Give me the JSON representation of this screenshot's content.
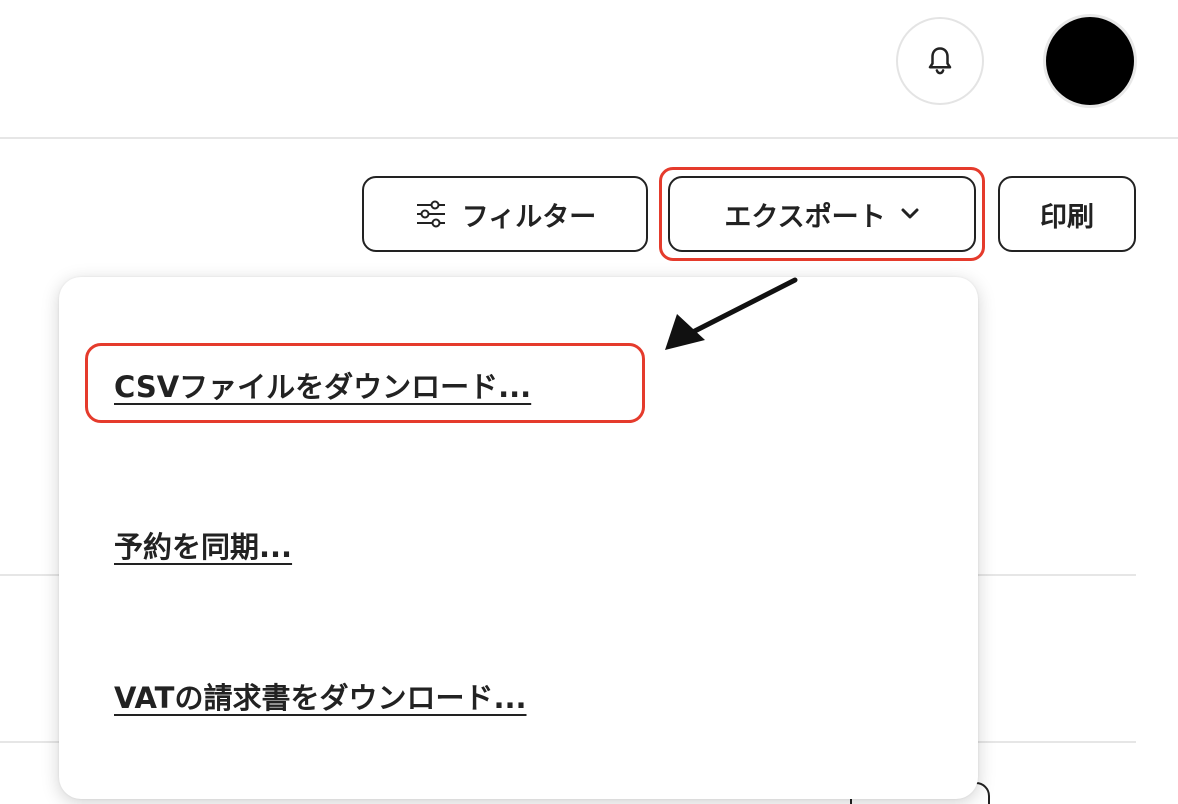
{
  "toolbar": {
    "filter_label": "フィルター",
    "export_label": "エクスポート",
    "print_label": "印刷"
  },
  "export_menu": {
    "items": [
      {
        "label": "CSVファイルをダウンロード..."
      },
      {
        "label": "予約を同期..."
      },
      {
        "label": "VATの請求書をダウンロード..."
      }
    ]
  },
  "icons": {
    "notification": "bell-icon",
    "filter": "sliders-icon",
    "export_chevron": "chevron-down-icon"
  },
  "colors": {
    "annotation_red": "#e53b2c",
    "text": "#222222",
    "avatar": "#000000"
  }
}
